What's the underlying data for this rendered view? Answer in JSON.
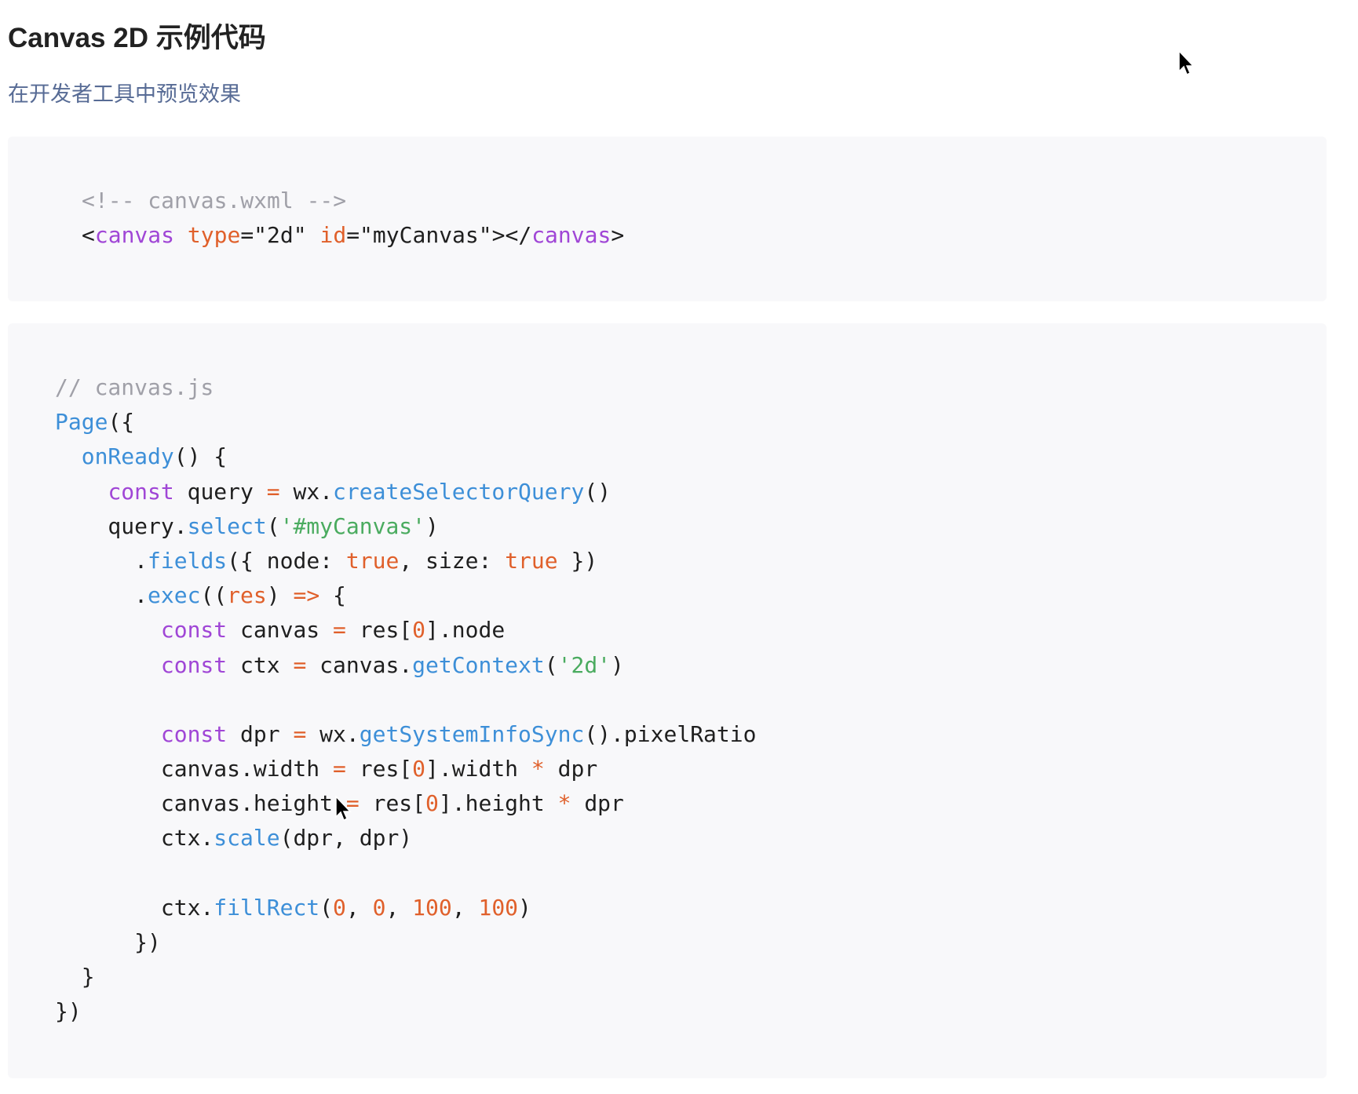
{
  "header": {
    "title": "Canvas 2D 示例代码",
    "link_text": "在开发者工具中预览效果"
  },
  "code_wxml": [
    [
      {
        "k": "c",
        "v": "<!-- canvas.wxml -->"
      }
    ],
    [
      {
        "k": "p",
        "v": "<"
      },
      {
        "k": "t",
        "v": "canvas"
      },
      {
        "k": "p",
        "v": " "
      },
      {
        "k": "a",
        "v": "type"
      },
      {
        "k": "p",
        "v": "=\"2d\" "
      },
      {
        "k": "a",
        "v": "id"
      },
      {
        "k": "p",
        "v": "=\"myCanvas\"></"
      },
      {
        "k": "t",
        "v": "canvas"
      },
      {
        "k": "p",
        "v": ">"
      }
    ]
  ],
  "code_js": [
    [
      {
        "k": "c",
        "v": "// canvas.js"
      }
    ],
    [
      {
        "k": "f",
        "v": "Page"
      },
      {
        "k": "p",
        "v": "({"
      }
    ],
    [
      {
        "k": "p",
        "v": "  "
      },
      {
        "k": "f",
        "v": "onReady"
      },
      {
        "k": "p",
        "v": "() {"
      }
    ],
    [
      {
        "k": "p",
        "v": "    "
      },
      {
        "k": "t",
        "v": "const"
      },
      {
        "k": "p",
        "v": " query "
      },
      {
        "k": "o",
        "v": "="
      },
      {
        "k": "p",
        "v": " wx."
      },
      {
        "k": "f",
        "v": "createSelectorQuery"
      },
      {
        "k": "p",
        "v": "()"
      }
    ],
    [
      {
        "k": "p",
        "v": "    query."
      },
      {
        "k": "f",
        "v": "select"
      },
      {
        "k": "p",
        "v": "("
      },
      {
        "k": "s",
        "v": "'#myCanvas'"
      },
      {
        "k": "p",
        "v": ")"
      }
    ],
    [
      {
        "k": "p",
        "v": "      ."
      },
      {
        "k": "f",
        "v": "fields"
      },
      {
        "k": "p",
        "v": "({ node: "
      },
      {
        "k": "a",
        "v": "true"
      },
      {
        "k": "p",
        "v": ", size: "
      },
      {
        "k": "a",
        "v": "true"
      },
      {
        "k": "p",
        "v": " })"
      }
    ],
    [
      {
        "k": "p",
        "v": "      ."
      },
      {
        "k": "f",
        "v": "exec"
      },
      {
        "k": "p",
        "v": "(("
      },
      {
        "k": "a",
        "v": "res"
      },
      {
        "k": "p",
        "v": ") "
      },
      {
        "k": "o",
        "v": "=>"
      },
      {
        "k": "p",
        "v": " {"
      }
    ],
    [
      {
        "k": "p",
        "v": "        "
      },
      {
        "k": "t",
        "v": "const"
      },
      {
        "k": "p",
        "v": " canvas "
      },
      {
        "k": "o",
        "v": "="
      },
      {
        "k": "p",
        "v": " res["
      },
      {
        "k": "a",
        "v": "0"
      },
      {
        "k": "p",
        "v": "].node"
      }
    ],
    [
      {
        "k": "p",
        "v": "        "
      },
      {
        "k": "t",
        "v": "const"
      },
      {
        "k": "p",
        "v": " ctx "
      },
      {
        "k": "o",
        "v": "="
      },
      {
        "k": "p",
        "v": " canvas."
      },
      {
        "k": "f",
        "v": "getContext"
      },
      {
        "k": "p",
        "v": "("
      },
      {
        "k": "s",
        "v": "'2d'"
      },
      {
        "k": "p",
        "v": ")"
      }
    ],
    [
      {
        "k": "p",
        "v": ""
      }
    ],
    [
      {
        "k": "p",
        "v": "        "
      },
      {
        "k": "t",
        "v": "const"
      },
      {
        "k": "p",
        "v": " dpr "
      },
      {
        "k": "o",
        "v": "="
      },
      {
        "k": "p",
        "v": " wx."
      },
      {
        "k": "f",
        "v": "getSystemInfoSync"
      },
      {
        "k": "p",
        "v": "().pixelRatio"
      }
    ],
    [
      {
        "k": "p",
        "v": "        canvas.width "
      },
      {
        "k": "o",
        "v": "="
      },
      {
        "k": "p",
        "v": " res["
      },
      {
        "k": "a",
        "v": "0"
      },
      {
        "k": "p",
        "v": "].width "
      },
      {
        "k": "o",
        "v": "*"
      },
      {
        "k": "p",
        "v": " dpr"
      }
    ],
    [
      {
        "k": "p",
        "v": "        canvas.height "
      },
      {
        "k": "o",
        "v": "="
      },
      {
        "k": "p",
        "v": " res["
      },
      {
        "k": "a",
        "v": "0"
      },
      {
        "k": "p",
        "v": "].height "
      },
      {
        "k": "o",
        "v": "*"
      },
      {
        "k": "p",
        "v": " dpr"
      }
    ],
    [
      {
        "k": "p",
        "v": "        ctx."
      },
      {
        "k": "f",
        "v": "scale"
      },
      {
        "k": "p",
        "v": "(dpr, dpr)"
      }
    ],
    [
      {
        "k": "p",
        "v": ""
      }
    ],
    [
      {
        "k": "p",
        "v": "        ctx."
      },
      {
        "k": "f",
        "v": "fillRect"
      },
      {
        "k": "p",
        "v": "("
      },
      {
        "k": "a",
        "v": "0"
      },
      {
        "k": "p",
        "v": ", "
      },
      {
        "k": "a",
        "v": "0"
      },
      {
        "k": "p",
        "v": ", "
      },
      {
        "k": "a",
        "v": "100"
      },
      {
        "k": "p",
        "v": ", "
      },
      {
        "k": "a",
        "v": "100"
      },
      {
        "k": "p",
        "v": ")"
      }
    ],
    [
      {
        "k": "p",
        "v": "      })"
      }
    ],
    [
      {
        "k": "p",
        "v": "  }"
      }
    ],
    [
      {
        "k": "p",
        "v": "})"
      }
    ]
  ],
  "colors": {
    "comment": "#a0a0a8",
    "keyword": "#a046d6",
    "attribute": "#e0602b",
    "function": "#3d8fd8",
    "string": "#4aab5f",
    "link": "#576b95",
    "code_background": "#f8f8fa"
  },
  "icons": {
    "cursor": "mouse-pointer-icon"
  }
}
